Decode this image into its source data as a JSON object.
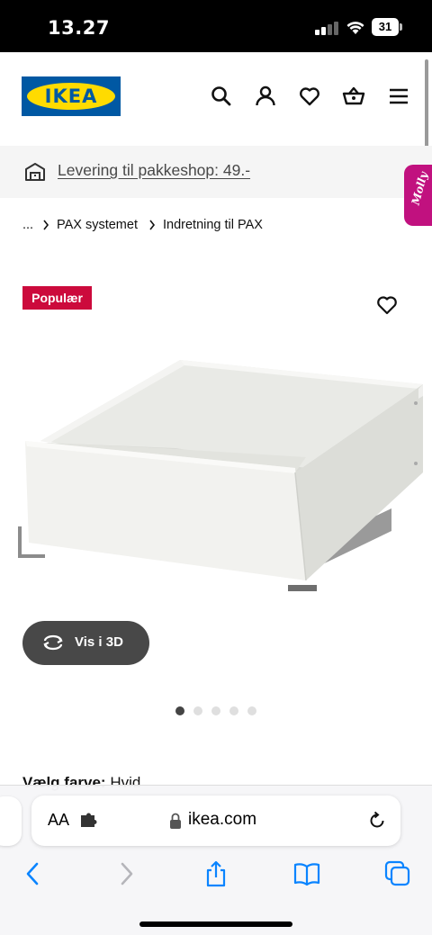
{
  "status_bar": {
    "time": "13.27",
    "battery": "31"
  },
  "header": {
    "logo_text": "IKEA",
    "icons": [
      "search-icon",
      "account-icon",
      "heart-icon",
      "basket-icon",
      "menu-icon"
    ]
  },
  "banner": {
    "text": "Levering til pakkeshop: 49.-"
  },
  "breadcrumb": {
    "items": [
      "...",
      "PAX systemet",
      "Indretning til PAX"
    ]
  },
  "product": {
    "badge": "Populær",
    "vis3d_label": "Vis i 3D",
    "carousel": {
      "total": 5,
      "active": 1
    },
    "color_label": "Vælg farve:",
    "color_value": "Hvid"
  },
  "browser": {
    "text_size": "AA",
    "url": "ikea.com"
  },
  "colors": {
    "ikea_blue": "#0058a3",
    "ikea_yellow": "#ffdb00",
    "badge_red": "#cc0a3c",
    "molly_pink": "#c1117f",
    "safari_blue": "#0a84ff"
  }
}
